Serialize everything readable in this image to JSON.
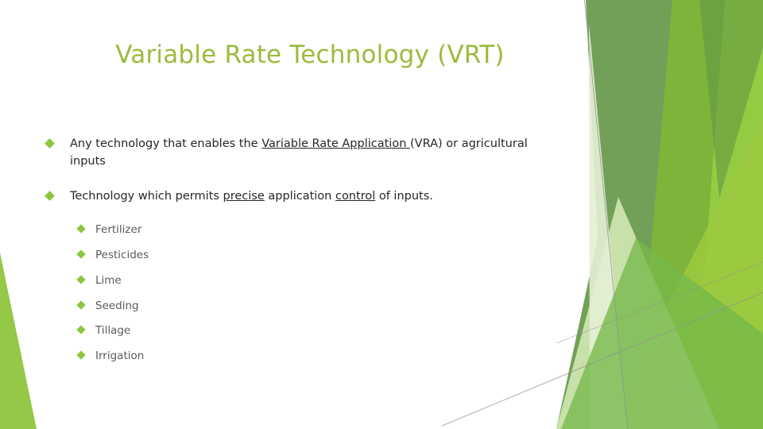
{
  "slide": {
    "title": "Variable Rate Technology (VRT)",
    "title_color": "#9bbb3c",
    "background_color": "#ffffff",
    "bullet_color": "#8cc63e",
    "body_text_color": "#262626",
    "sub_text_color": "#5a5a5a"
  },
  "bullets": [
    {
      "segments": [
        {
          "text": "Any technology that enables the ",
          "underline": false
        },
        {
          "text": "Variable Rate Application ",
          "underline": true
        },
        {
          "text": "(VRA) or agricultural inputs",
          "underline": false
        }
      ]
    },
    {
      "segments": [
        {
          "text": "Technology which permits ",
          "underline": false
        },
        {
          "text": "precise",
          "underline": true
        },
        {
          "text": " application ",
          "underline": false
        },
        {
          "text": "control",
          "underline": true
        },
        {
          "text": " of inputs.",
          "underline": false
        }
      ]
    }
  ],
  "sub_bullets": [
    {
      "label": "Fertilizer"
    },
    {
      "label": "Pesticides"
    },
    {
      "label": "Lime"
    },
    {
      "label": "Seeding"
    },
    {
      "label": "Tillage"
    },
    {
      "label": "Irrigation"
    }
  ],
  "decor": {
    "name": "facet-green-polygons",
    "colors": {
      "left_wedge": "#94c846",
      "dark_olive": "#6c9b50",
      "mid_green": "#7fb53a",
      "bright_green": "#97cc42",
      "light_green": "#9bc93f",
      "pale_green": "#cfe5b0",
      "palest_green": "#e4f0d4",
      "hairline": "#8f8f8f"
    }
  }
}
